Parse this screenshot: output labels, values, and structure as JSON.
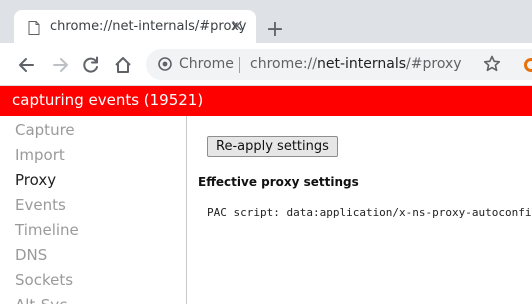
{
  "tab": {
    "title": "chrome://net-internals/#proxy",
    "close_glyph": "×",
    "new_tab_glyph": "+"
  },
  "toolbar": {
    "site_chip": "Chrome",
    "url_prefix": "chrome://",
    "url_host": "net-internals",
    "url_suffix": "/#proxy"
  },
  "status": {
    "text": "capturing events (19521)",
    "color": "#ff0000"
  },
  "sidebar": {
    "items": [
      {
        "label": "Capture"
      },
      {
        "label": "Import"
      },
      {
        "label": "Proxy"
      },
      {
        "label": "Events"
      },
      {
        "label": "Timeline"
      },
      {
        "label": "DNS"
      },
      {
        "label": "Sockets"
      },
      {
        "label": "Alt-Svc"
      }
    ],
    "active": "Proxy"
  },
  "main": {
    "reapply_label": "Re-apply settings",
    "effective_title": "Effective proxy settings",
    "pac_line": "PAC script: data:application/x-ns-proxy-autoconfig"
  }
}
